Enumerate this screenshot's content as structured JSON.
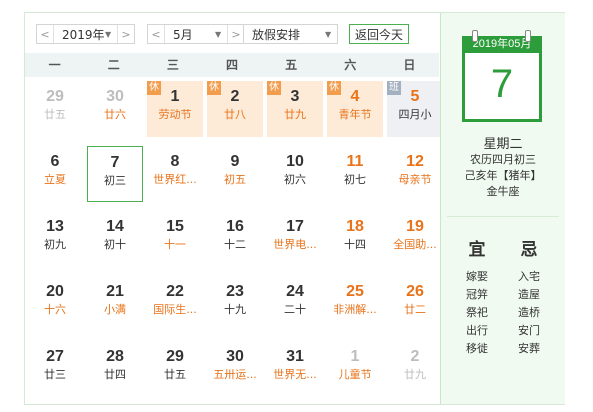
{
  "toolbar": {
    "year": "2019年",
    "month": "5月",
    "holiday": "放假安排",
    "today": "返回今天",
    "prev": "<",
    "next": ">"
  },
  "weekdays": [
    "一",
    "二",
    "三",
    "四",
    "五",
    "六",
    "日"
  ],
  "days": [
    {
      "num": "29",
      "lunar": "廿五",
      "dim": true
    },
    {
      "num": "30",
      "lunar": "廿六",
      "dim": true,
      "lunarRed": true
    },
    {
      "num": "1",
      "lunar": "劳动节",
      "holiday": true,
      "tag": "休",
      "lunarRed": true
    },
    {
      "num": "2",
      "lunar": "廿八",
      "holiday": true,
      "tag": "休",
      "lunarRed": true
    },
    {
      "num": "3",
      "lunar": "廿九",
      "holiday": true,
      "tag": "休",
      "lunarRed": true
    },
    {
      "num": "4",
      "lunar": "青年节",
      "holiday": true,
      "tag": "休",
      "weekend": true,
      "lunarRed": true
    },
    {
      "num": "5",
      "lunar": "四月小",
      "work": true,
      "tag": "班",
      "weekend": true
    },
    {
      "num": "6",
      "lunar": "立夏",
      "lunarRed": true
    },
    {
      "num": "7",
      "lunar": "初三",
      "selected": true
    },
    {
      "num": "8",
      "lunar": "世界红...",
      "lunarRed": true
    },
    {
      "num": "9",
      "lunar": "初五",
      "lunarRed": true
    },
    {
      "num": "10",
      "lunar": "初六"
    },
    {
      "num": "11",
      "lunar": "初七",
      "weekend": true
    },
    {
      "num": "12",
      "lunar": "母亲节",
      "weekend": true,
      "lunarRed": true
    },
    {
      "num": "13",
      "lunar": "初九"
    },
    {
      "num": "14",
      "lunar": "初十"
    },
    {
      "num": "15",
      "lunar": "十一",
      "lunarRed": true
    },
    {
      "num": "16",
      "lunar": "十二"
    },
    {
      "num": "17",
      "lunar": "世界电...",
      "lunarRed": true
    },
    {
      "num": "18",
      "lunar": "十四",
      "weekend": true
    },
    {
      "num": "19",
      "lunar": "全国助...",
      "weekend": true,
      "lunarRed": true
    },
    {
      "num": "20",
      "lunar": "十六",
      "lunarRed": true
    },
    {
      "num": "21",
      "lunar": "小满",
      "lunarRed": true
    },
    {
      "num": "22",
      "lunar": "国际生...",
      "lunarRed": true
    },
    {
      "num": "23",
      "lunar": "十九"
    },
    {
      "num": "24",
      "lunar": "二十"
    },
    {
      "num": "25",
      "lunar": "非洲解...",
      "weekend": true,
      "lunarRed": true
    },
    {
      "num": "26",
      "lunar": "廿二",
      "weekend": true,
      "lunarRed": true
    },
    {
      "num": "27",
      "lunar": "廿三"
    },
    {
      "num": "28",
      "lunar": "廿四"
    },
    {
      "num": "29",
      "lunar": "廿五"
    },
    {
      "num": "30",
      "lunar": "五卅运...",
      "lunarRed": true
    },
    {
      "num": "31",
      "lunar": "世界无...",
      "lunarRed": true
    },
    {
      "num": "1",
      "lunar": "儿童节",
      "dim": true,
      "lunarRed": true
    },
    {
      "num": "2",
      "lunar": "廿九",
      "dim": true
    }
  ],
  "panel": {
    "month": "2019年05月",
    "day": "7",
    "weekday": "星期二",
    "lunar": "农历四月初三",
    "ganzhi": "己亥年【猪年】",
    "star": "金牛座",
    "yi_title": "宜",
    "ji_title": "忌",
    "yi": [
      "嫁娶",
      "冠笄",
      "祭祀",
      "出行",
      "移徙"
    ],
    "ji": [
      "入宅",
      "造屋",
      "造桥",
      "安门",
      "安葬"
    ]
  }
}
